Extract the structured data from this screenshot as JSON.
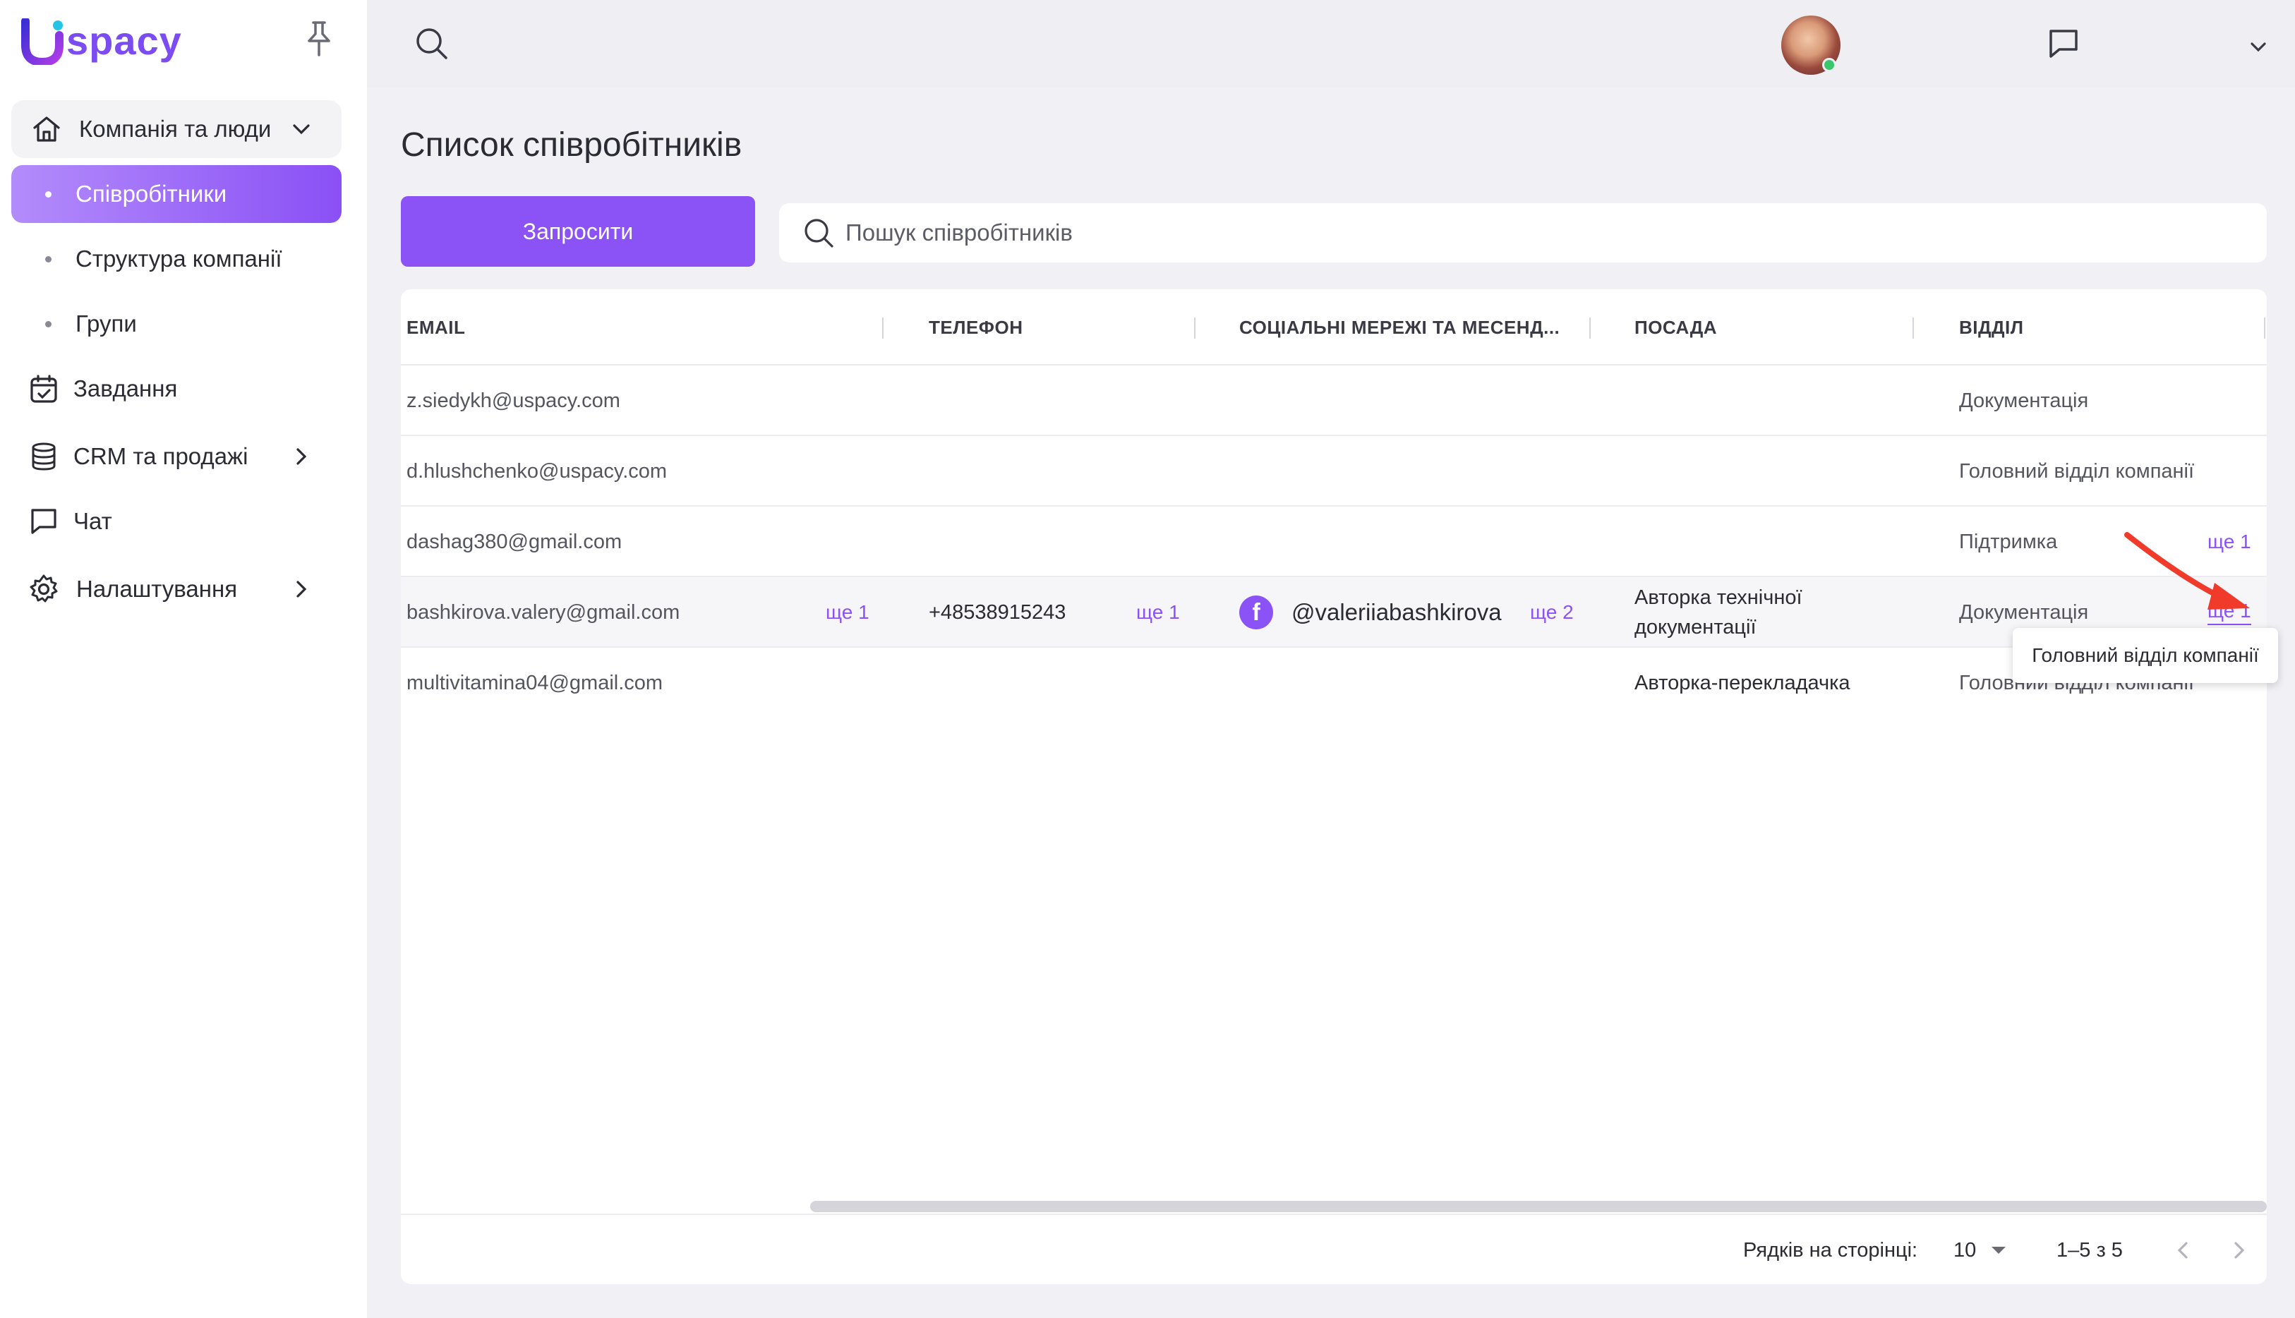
{
  "app": {
    "logo_text": "spacy",
    "logo_letter": "U"
  },
  "sidebar": {
    "company": "Компанія та люди",
    "sub_items": [
      "Співробітники",
      "Структура компанії",
      "Групи"
    ],
    "tasks": "Завдання",
    "crm": "CRM та продажі",
    "chat": "Чат",
    "settings": "Налаштування"
  },
  "page": {
    "title": "Список співробітників",
    "invite_label": "Запросити",
    "search_placeholder": "Пошук співробітників"
  },
  "table": {
    "headers": [
      "EMAIL",
      "ТЕЛЕФОН",
      "СОЦІАЛЬНІ МЕРЕЖІ ТА МЕСЕНД...",
      "ПОСАДА",
      "ВІДДІЛ"
    ],
    "rows": [
      {
        "email": "z.siedykh@uspacy.com",
        "department": "Документація"
      },
      {
        "email": "d.hlushchenko@uspacy.com",
        "department": "Головний відділ компанії"
      },
      {
        "email": "dashag380@gmail.com",
        "department": "Підтримка",
        "department_more": "ще 1"
      },
      {
        "email": "bashkirova.valery@gmail.com",
        "email_more": "ще 1",
        "phone": "+48538915243",
        "phone_more": "ще 1",
        "social": "@valeriiabashkirova",
        "social_more": "ще 2",
        "position_line1": "Авторка технічної",
        "position_line2": "документації",
        "department": "Документація",
        "department_more": "ще 1"
      },
      {
        "email": "multivitamina04@gmail.com",
        "position": "Авторка-перекладачка",
        "department": "Головний відділ компанії"
      }
    ]
  },
  "tooltip": "Головний відділ компанії",
  "pagination": {
    "label": "Рядків на сторінці:",
    "rows_per_page": "10",
    "range": "1–5 з 5"
  },
  "colors": {
    "accent": "#8b52f5",
    "sidebar_bg": "#ffffff",
    "page_bg": "#f1f0f5",
    "arrow": "#f03a2a",
    "online": "#38c86b"
  }
}
